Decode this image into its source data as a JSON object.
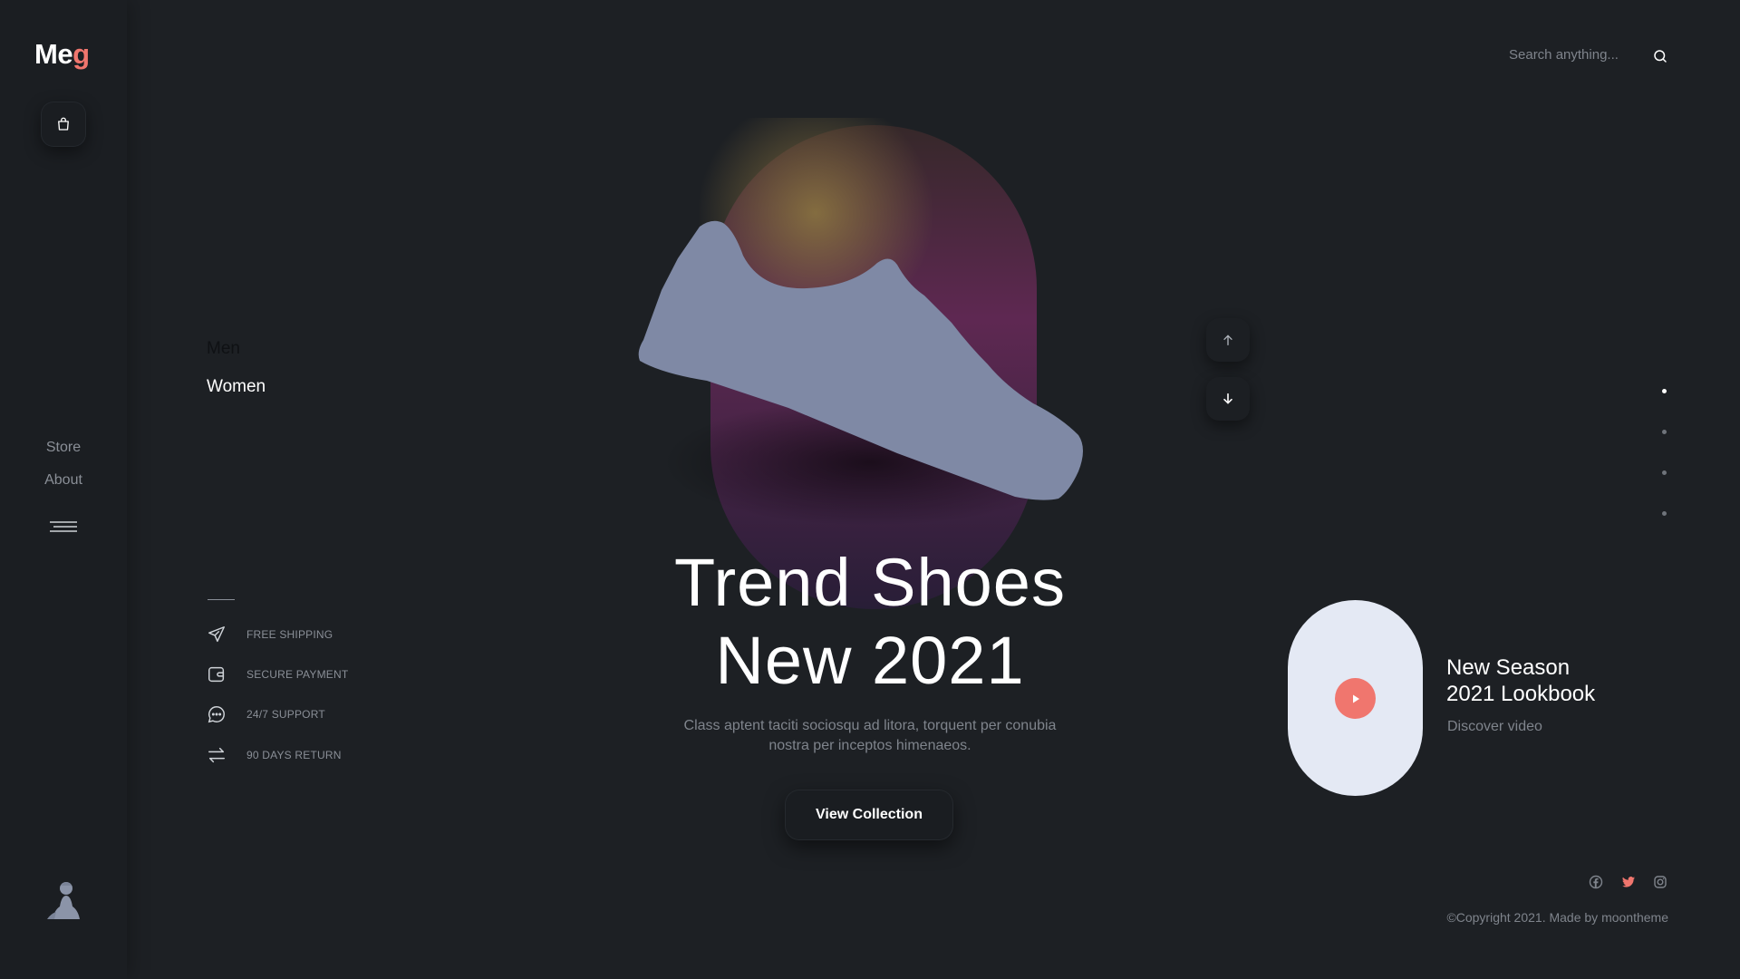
{
  "brand": {
    "logo_main": "Me",
    "logo_accent": "g",
    "accent_color": "#f0766e"
  },
  "sidebar": {
    "links": [
      {
        "label": "Store"
      },
      {
        "label": "About"
      }
    ]
  },
  "categories": [
    {
      "label": "Men"
    },
    {
      "label": "Women"
    }
  ],
  "features": [
    {
      "icon": "paper-plane-icon",
      "label": "FREE SHIPPING"
    },
    {
      "icon": "wallet-icon",
      "label": "SECURE PAYMENT"
    },
    {
      "icon": "chat-bubble-icon",
      "label": "24/7 SUPPORT"
    },
    {
      "icon": "exchange-arrows-icon",
      "label": "90 DAYS RETURN"
    }
  ],
  "search": {
    "placeholder": "Search anything..."
  },
  "hero": {
    "title_line1": "Trend Shoes",
    "title_line2": "New 2021",
    "description": "Class aptent taciti sociosqu ad litora, torquent per conubia nostra per inceptos himenaeos.",
    "cta_label": "View Collection"
  },
  "slider": {
    "dots": 4,
    "active_index": 0
  },
  "video": {
    "title_line1": "New Season",
    "title_line2": "2021 Lookbook",
    "subtitle": "Discover video"
  },
  "social": [
    {
      "icon": "facebook-icon",
      "color": "#7f848c"
    },
    {
      "icon": "twitter-icon",
      "color": "#f0766e"
    },
    {
      "icon": "instagram-icon",
      "color": "#7f848c"
    }
  ],
  "footer": {
    "copyright": "©Copyright 2021. Made by moontheme"
  }
}
